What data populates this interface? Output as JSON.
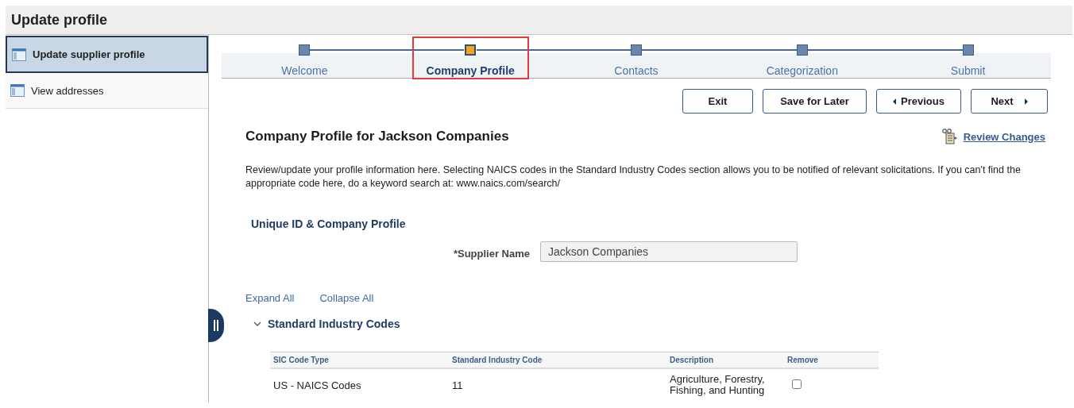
{
  "header": {
    "title": "Update profile"
  },
  "sidebar": {
    "items": [
      {
        "label": "Update supplier profile",
        "selected": true
      },
      {
        "label": "View addresses",
        "selected": false
      }
    ]
  },
  "steps": [
    {
      "label": "Welcome",
      "selected": false,
      "highlighted": false
    },
    {
      "label": "Company Profile",
      "selected": true,
      "highlighted": true
    },
    {
      "label": "Contacts",
      "selected": false,
      "highlighted": false
    },
    {
      "label": "Categorization",
      "selected": false,
      "highlighted": false
    },
    {
      "label": "Submit",
      "selected": false,
      "highlighted": false
    }
  ],
  "buttons": [
    {
      "label": "Exit",
      "kind": "plain"
    },
    {
      "label": "Save for Later",
      "kind": "plain"
    },
    {
      "label": "Previous",
      "kind": "back"
    },
    {
      "label": "Next",
      "kind": "forward"
    }
  ],
  "page_title": {
    "prefix": "Company Profile for ",
    "name": "Jackson Companies"
  },
  "review_link": "Review Changes",
  "description": "Review/update your profile information here. Selecting NAICS codes in the Standard Industry Codes section allows you to be notified of relevant solicitations. If you can't find the appropriate code here, do a keyword search at: www.naics.com/search/",
  "section_title": "Unique ID & Company Profile",
  "supplier_field": {
    "label": "*Supplier Name",
    "value": "Jackson Companies",
    "disabled": true
  },
  "expand_all": "Expand All",
  "collapse_all": "Collapse All",
  "group": {
    "title": "Standard Industry Codes",
    "expanded": true
  },
  "table": {
    "columns": [
      "SIC Code Type",
      "Standard Industry Code",
      "Description",
      "Remove"
    ],
    "rows": [
      {
        "type": "US - NAICS Codes",
        "code": "11",
        "description": "Agriculture, Forestry, Fishing, and Hunting",
        "remove": false
      }
    ]
  }
}
